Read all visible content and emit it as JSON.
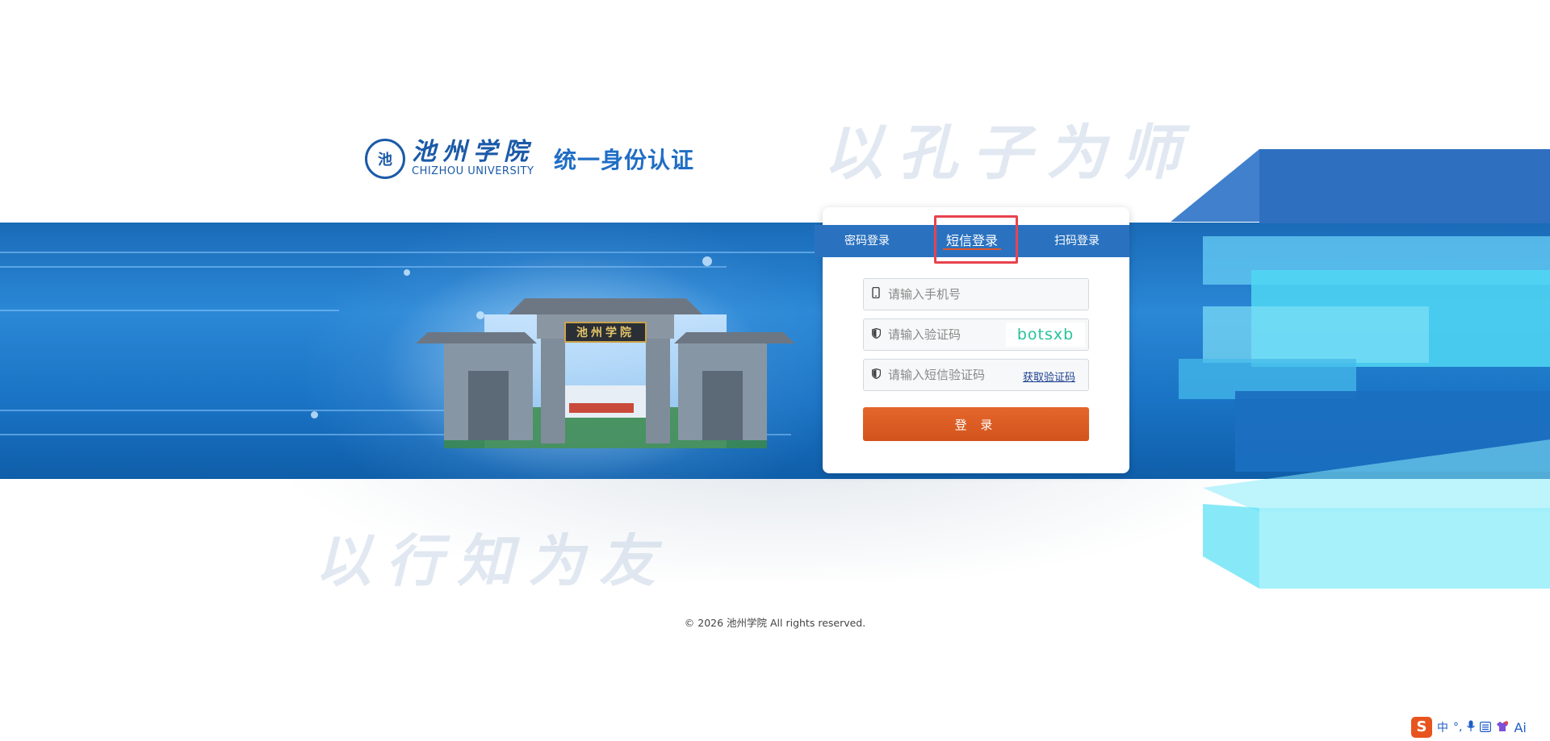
{
  "header": {
    "seal_char": "池",
    "school_name_cn": "池州学院",
    "school_name_en": "CHIZHOU UNIVERSITY",
    "system_title": "统一身份认证"
  },
  "mottos": {
    "top": "以孔子为师",
    "bottom": "以行知为友"
  },
  "gate": {
    "plaque": "池州学院"
  },
  "login": {
    "tabs": [
      {
        "label": "密码登录",
        "active": false
      },
      {
        "label": "短信登录",
        "active": true
      },
      {
        "label": "扫码登录",
        "active": false
      }
    ],
    "phone_placeholder": "请输入手机号",
    "captcha_placeholder": "请输入验证码",
    "captcha_text": "botsxb",
    "sms_placeholder": "请输入短信验证码",
    "get_code_label": "获取验证码",
    "submit_label": "登 录"
  },
  "footer": {
    "copyright": "© 2026 池州学院 All rights reserved."
  },
  "ime": {
    "logo": "S",
    "mode": "中",
    "punct": "°,",
    "ai": "Ai"
  },
  "colors": {
    "brand_blue": "#1b5aa8",
    "tab_bar": "#2a72c0",
    "accent_orange": "#d9591f",
    "captcha_green": "#27c29b",
    "highlight_red": "#e8434c"
  }
}
